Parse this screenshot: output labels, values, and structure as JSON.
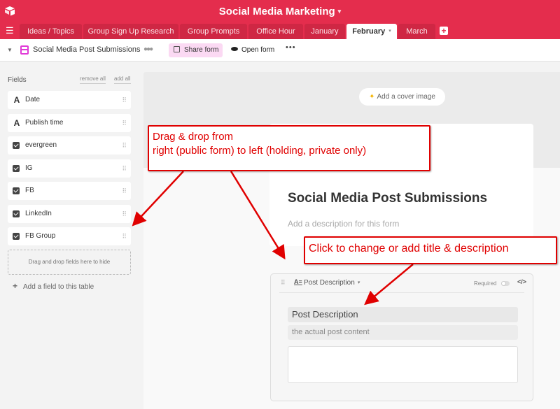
{
  "app": {
    "title": "Social Media Marketing",
    "title_caret": "▾",
    "logo_icon": "airtable-logo-icon",
    "menu_icon": "☰",
    "brand_color": "#e42d4d"
  },
  "tabs": [
    {
      "label": "Ideas / Topics",
      "active": false
    },
    {
      "label": "Group Sign Up Research",
      "active": false
    },
    {
      "label": "Group Prompts",
      "active": false
    },
    {
      "label": "Office Hour",
      "active": false
    },
    {
      "label": "January",
      "active": false
    },
    {
      "label": "February",
      "active": true,
      "caret": "▾"
    },
    {
      "label": "March",
      "active": false
    }
  ],
  "add_tab_icon": "+",
  "toolbar": {
    "collapse_icon": "▼",
    "view_name": "Social Media Post Submissions",
    "people_icon": "👥",
    "share_label": "Share form",
    "open_label": "Open form",
    "more_label": "•••"
  },
  "fields_panel": {
    "title": "Fields",
    "remove_all": "remove all",
    "add_all": "add all",
    "fields": [
      {
        "name": "Date",
        "type": "text",
        "type_glyph": "A"
      },
      {
        "name": "Publish time",
        "type": "text",
        "type_glyph": "A"
      },
      {
        "name": "evergreen",
        "type": "checkbox"
      },
      {
        "name": "IG",
        "type": "checkbox"
      },
      {
        "name": "FB",
        "type": "checkbox"
      },
      {
        "name": "LinkedIn",
        "type": "checkbox"
      },
      {
        "name": "FB Group",
        "type": "checkbox"
      }
    ],
    "grip_glyph": "⠿",
    "drop_zone_text": "Drag and drop fields here to hide",
    "add_field_plus": "+",
    "add_field_label": "Add a field to this table"
  },
  "form": {
    "cover_icon": "✦",
    "cover_label": "Add a cover image",
    "title": "Social Media Post Submissions",
    "description_placeholder": "Add a description for this form",
    "question": {
      "grip": "⠿",
      "type_icon": "A≡",
      "type_label": "Post Description",
      "type_caret": "▾",
      "required_label": "Required",
      "required_on": false,
      "code_icon": "</>",
      "label": "Post Description",
      "help_text": "the actual post content",
      "input_value": ""
    }
  },
  "annotations": [
    {
      "line1": "Drag & drop from",
      "line2": "right (public form) to left (holding, private only)"
    },
    {
      "text": "Click to change or add title & description"
    }
  ],
  "annotation_color": "#e00000"
}
